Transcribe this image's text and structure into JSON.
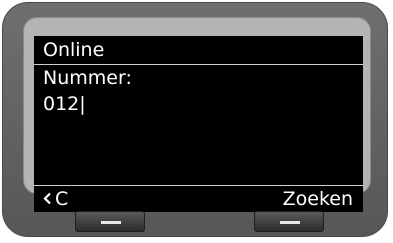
{
  "screen": {
    "status_title": "Online",
    "field_label": "Nummer:",
    "field_value": "012|",
    "softkeys": {
      "left_icon": "back-arrow-icon",
      "left_label": "C",
      "right_label": "Zoeken"
    }
  },
  "colors": {
    "display_bg": "#000000",
    "display_text": "#ffffff",
    "housing": "#5f5f5f",
    "bezel": "#b4b4b4"
  }
}
